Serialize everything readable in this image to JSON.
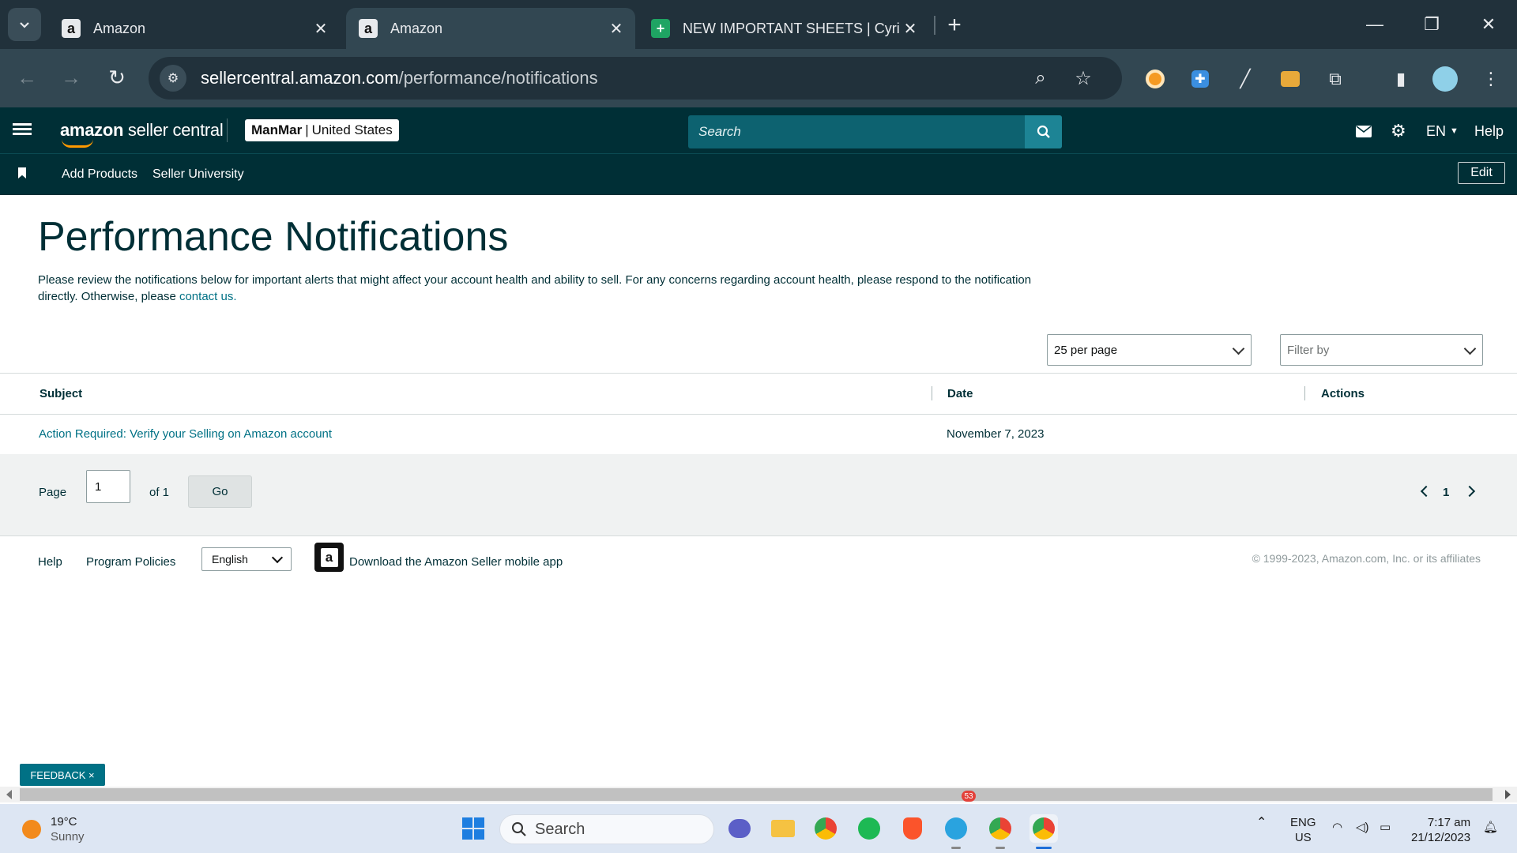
{
  "browser": {
    "tabs": [
      {
        "title": "Amazon",
        "favicon": "amazon-icon",
        "active": false
      },
      {
        "title": "Amazon",
        "favicon": "amazon-icon",
        "active": true
      },
      {
        "title": "NEW IMPORTANT SHEETS | Cyril -",
        "favicon": "google-sheets-icon",
        "active": false
      }
    ],
    "url_host": "sellercentral.amazon.com",
    "url_path": "/performance/notifications"
  },
  "header": {
    "logo_bold": "amazon",
    "logo_light": " seller central",
    "account_store": "ManMar",
    "account_sep": "|",
    "account_region": "United States",
    "search_placeholder": "Search",
    "language": "EN",
    "help": "Help"
  },
  "subnav": {
    "items": [
      "Add Products",
      "Seller University"
    ],
    "edit": "Edit"
  },
  "main": {
    "title": "Performance Notifications",
    "intro_text": "Please review the notifications below for important alerts that might affect your account health and ability to sell. For any concerns regarding account health, please respond to the notification directly. Otherwise, please ",
    "intro_link": "contact us.",
    "per_page": "25 per page",
    "filter_placeholder": "Filter by"
  },
  "table": {
    "columns": [
      "Subject",
      "Date",
      "Actions"
    ],
    "rows": [
      {
        "subject": "Action Required: Verify your Selling on Amazon account",
        "date": "November 7, 2023",
        "actions": ""
      }
    ]
  },
  "pagination": {
    "page_label": "Page",
    "current_page": "1",
    "of_label": "of 1",
    "go": "Go",
    "page_number": "1"
  },
  "footer": {
    "help": "Help",
    "policies": "Program Policies",
    "language": "English",
    "app_text": "Download the Amazon Seller mobile app",
    "copyright": "© 1999-2023, Amazon.com, Inc. or its affiliates"
  },
  "feedback": "FEEDBACK ×",
  "taskbar": {
    "temperature": "19°C",
    "condition": "Sunny",
    "search": "Search",
    "lang_top": "ENG",
    "lang_bottom": "US",
    "time": "7:17 am",
    "date": "21/12/2023",
    "telegram_badge": "53"
  }
}
